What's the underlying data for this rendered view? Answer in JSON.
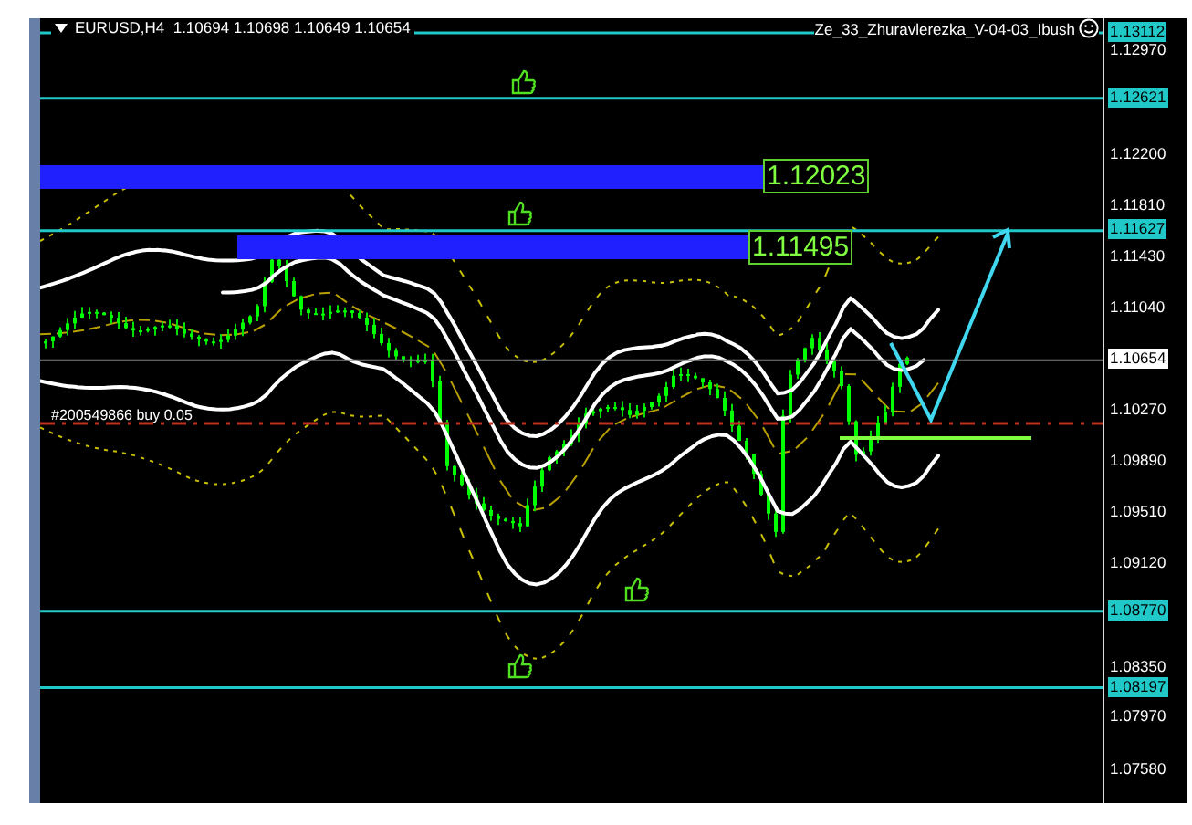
{
  "chart": {
    "symbol_line": "EURUSD,H4  1.10694 1.10698 1.10649 1.10654",
    "expert_name": "Ze_33_Zhuravlerezka_V-04-03_Ibush",
    "order_label": "#200549866 buy 0.05",
    "current_price": "1.10654",
    "levels": [
      {
        "price": "1.13112"
      },
      {
        "price": "1.12621"
      },
      {
        "price": "1.11627"
      },
      {
        "price": "1.08770"
      },
      {
        "price": "1.08197"
      }
    ],
    "zones": [
      {
        "label": "1.12023"
      },
      {
        "label": "1.11495"
      }
    ],
    "axis_ticks": [
      "1.12970",
      "1.12200",
      "1.11810",
      "1.11430",
      "1.11040",
      "1.10270",
      "1.09890",
      "1.09510",
      "1.09120",
      "1.08350",
      "1.07970",
      "1.07580"
    ]
  }
}
